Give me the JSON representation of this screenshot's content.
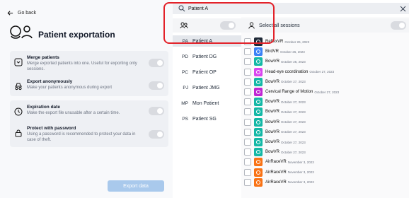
{
  "nav": {
    "back_label": "Go back"
  },
  "page": {
    "title": "Patient exportation"
  },
  "options": [
    {
      "title": "Merge patients",
      "desc": "Merge exported patients into one. Useful for exporting only sessions."
    },
    {
      "title": "Export anonymously",
      "desc": "Make your patients anonymous during export"
    },
    {
      "title": "Expiration date",
      "desc": "Make the export file unusable after a certain time."
    },
    {
      "title": "Protect with password",
      "desc": "Using a password is recommended to protect your data in case of theft."
    }
  ],
  "export_button": "Export data",
  "search": {
    "value": "Patient A"
  },
  "select_all_label": "Select all sessions",
  "patients": [
    {
      "code": "PA",
      "name": "Patient A",
      "selected": true
    },
    {
      "code": "PD",
      "name": "Patient DG"
    },
    {
      "code": "PC",
      "name": "Patient OP"
    },
    {
      "code": "PJ",
      "name": "Patient JMG"
    },
    {
      "code": "MP",
      "name": "Mon Patient"
    },
    {
      "code": "PS",
      "name": "Patient SG"
    }
  ],
  "sessions": [
    {
      "name": "ReflexVR",
      "date": "October 26, 2023",
      "color": "#1f2937"
    },
    {
      "name": "BirdVR",
      "date": "October 26, 2023",
      "color": "#3b82f6"
    },
    {
      "name": "BowVR",
      "date": "October 26, 2023",
      "color": "#14b8a6"
    },
    {
      "name": "Head-eye coordination",
      "date": "October 27, 2023",
      "color": "#d946ef"
    },
    {
      "name": "BowVR",
      "date": "October 27, 2023",
      "color": "#14b8a6"
    },
    {
      "name": "Cervical Range of Motion",
      "date": "October 27, 2023",
      "color": "#c026d3"
    },
    {
      "name": "BowVR",
      "date": "October 27, 2023",
      "color": "#14b8a6"
    },
    {
      "name": "BowVR",
      "date": "October 27, 2023",
      "color": "#14b8a6"
    },
    {
      "name": "BowVR",
      "date": "October 27, 2023",
      "color": "#14b8a6"
    },
    {
      "name": "BowVR",
      "date": "October 27, 2023",
      "color": "#14b8a6"
    },
    {
      "name": "BowVR",
      "date": "October 27, 2023",
      "color": "#14b8a6"
    },
    {
      "name": "BowVR",
      "date": "October 27, 2023",
      "color": "#14b8a6"
    },
    {
      "name": "AirRaceVR",
      "date": "November 3, 2023",
      "color": "#f97316"
    },
    {
      "name": "AirRaceVR",
      "date": "November 3, 2023",
      "color": "#f97316"
    },
    {
      "name": "AirRaceVR",
      "date": "November 3, 2023",
      "color": "#f97316"
    }
  ]
}
